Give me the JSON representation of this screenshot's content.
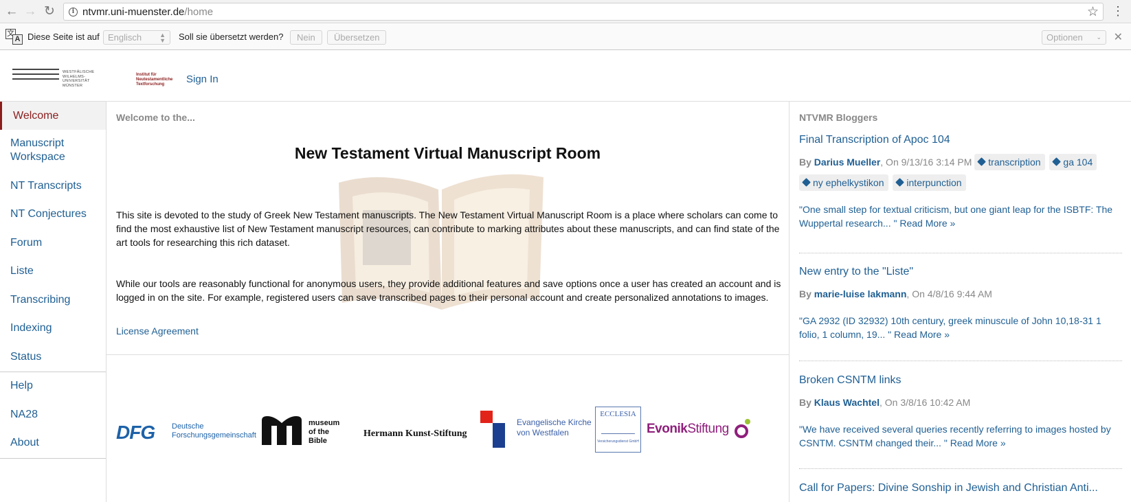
{
  "browser": {
    "url_host": "ntvmr.uni-muenster.de",
    "url_path": "/home"
  },
  "translate_bar": {
    "prefix": "Diese Seite ist auf",
    "language": "Englisch",
    "question": "Soll sie übersetzt werden?",
    "no_label": "Nein",
    "translate_label": "Übersetzen",
    "options_label": "Optionen"
  },
  "header": {
    "uni_logo_text": "Westfälische Wilhelms-Universität Münster",
    "inst_logo_text": "Institut für Neutestamentliche Textforschung",
    "sign_in": "Sign In"
  },
  "sidebar": {
    "items": [
      {
        "label": "Welcome"
      },
      {
        "label": "Manuscript Workspace"
      },
      {
        "label": "NT Transcripts"
      },
      {
        "label": "NT Conjectures"
      },
      {
        "label": "Forum"
      },
      {
        "label": "Liste"
      },
      {
        "label": "Transcribing"
      },
      {
        "label": "Indexing"
      },
      {
        "label": "Status"
      },
      {
        "label": "Help"
      },
      {
        "label": "NA28"
      },
      {
        "label": "About"
      }
    ]
  },
  "main": {
    "kicker": "Welcome to the...",
    "title": "New Testament Virtual Manuscript Room",
    "para1": "This site is devoted to the study of Greek New Testament manuscripts. The New Testament Virtual Manuscript Room is a place where scholars can come to find the most exhaustive list of New Testament manuscript resources, can contribute to marking attributes about these manuscripts, and can find state of the art tools for researching this rich dataset.",
    "para2": "While our tools are reasonably functional for anonymous users, they provide additional features and save options once a user has created an account and is logged in on the site. For example, registered users can save transcribed pages to their personal account and create personalized annotations to images.",
    "license": "License Agreement"
  },
  "sponsors": {
    "dfg_mark": "DFG",
    "dfg_line1": "Deutsche",
    "dfg_line2": "Forschungsgemeinschaft",
    "mob_line1": "museum",
    "mob_line2": "of the",
    "mob_line3": "Bible",
    "hks": "Hermann Kunst-Stiftung",
    "ekvw_line1": "Evangelische Kirche",
    "ekvw_line2": "von Westfalen",
    "ecclesia": "ECCLESIA",
    "ecclesia_sub": "Versicherungsdienst GmbH",
    "evonik_bold": "Evonik",
    "evonik_light": "Stiftung"
  },
  "bloggers": {
    "heading": "NTVMR Bloggers",
    "posts": [
      {
        "title": "Final Transcription of Apoc 104",
        "by": "By",
        "author": "Darius Mueller",
        "date": ", On 9/13/16 3:14 PM",
        "tags": [
          "transcription",
          "ga 104",
          "ny ephelkystikon",
          "interpunction"
        ],
        "excerpt": "\"One small step for textual criticism, but one giant leap for the ISBTF: The Wuppertal research... \"",
        "read_more": "Read More »"
      },
      {
        "title": "New entry to the \"Liste\"",
        "by": "By",
        "author": "marie-luise lakmann",
        "date": ", On 4/8/16 9:44 AM",
        "tags": [],
        "excerpt": "\"GA 2932   (ID 32932) 10th century, greek minuscule of John 10,18-31 1 folio, 1 column, 19... \"",
        "read_more": "Read More »"
      },
      {
        "title": "Broken CSNTM links",
        "by": "By",
        "author": "Klaus Wachtel",
        "date": ", On 3/8/16 10:42 AM",
        "tags": [],
        "excerpt": "\"We have received several queries recently referring to images hosted by CSNTM. CSNTM changed their... \"",
        "read_more": "Read More »"
      },
      {
        "title": "Call for Papers: Divine Sonship in Jewish and Christian Anti..."
      }
    ]
  },
  "colors": {
    "link": "#1f5f93",
    "active": "#8b1d1d",
    "muted": "#888888"
  }
}
